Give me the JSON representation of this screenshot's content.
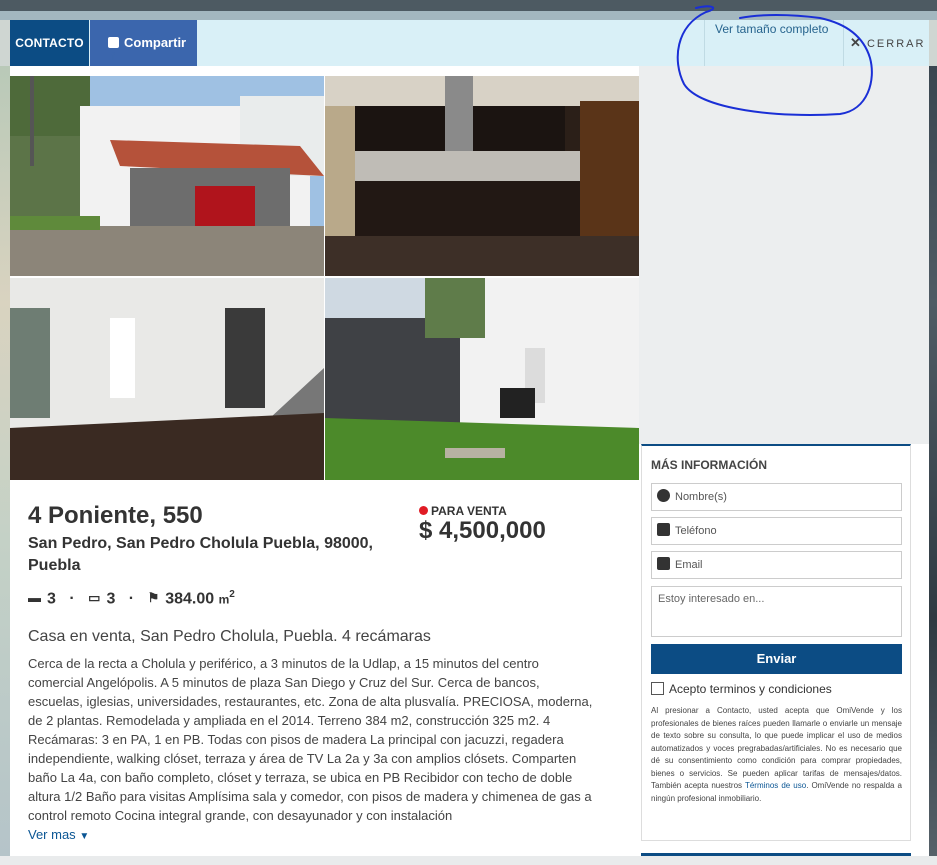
{
  "header": {
    "contact_label": "CONTACTO",
    "share_label": "Compartir",
    "full_size_label": "Ver tamaño completo",
    "close_label": "CERRAR"
  },
  "gallery": [
    {
      "name": "photo-house-exterior"
    },
    {
      "name": "photo-kitchen"
    },
    {
      "name": "photo-living-room"
    },
    {
      "name": "photo-garden"
    }
  ],
  "listing": {
    "title": "4 Poniente, 550",
    "address": "San Pedro, San Pedro Cholula Puebla, 98000, Puebla",
    "status": "PARA VENTA",
    "price": "$ 4,500,000",
    "bedrooms": "3",
    "bathrooms": "3",
    "area": "384.00",
    "area_unit": "m",
    "area_exp": "2",
    "separator": "·",
    "subtitle": "Casa en venta, San Pedro Cholula, Puebla. 4 recámaras",
    "description": "Cerca de la recta a Cholula y periférico, a 3 minutos de la Udlap, a 15 minutos del centro comercial Angelópolis. A 5 minutos de plaza San Diego y Cruz del Sur. Cerca de bancos, escuelas, iglesias, universidades, restaurantes, etc. Zona de alta plusvalía. PRECIOSA, moderna, de 2 plantas. Remodelada y ampliada en el 2014. Terreno 384 m2, construcción 325 m2. 4 Recámaras: 3 en PA, 1 en PB. Todas con pisos de madera La principal con jacuzzi, regadera independiente, walking clóset, terraza y área de TV La 2a y 3a con amplios clósets. Comparten baño La 4a, con baño completo, clóset y terraza, se ubica en PB Recibidor con techo de doble altura 1/2 Baño para visitas Amplísima sala y comedor, con pisos de madera y chimenea de gas a control remoto Cocina integral grande, con desayunador y con instalación",
    "see_more": "Ver mas"
  },
  "form": {
    "title": "MÁS INFORMACIÓN",
    "name_placeholder": "Nombre(s)",
    "phone_placeholder": "Teléfono",
    "email_placeholder": "Email",
    "message_placeholder": "Estoy interesado en...",
    "submit_label": "Enviar",
    "terms_label": "Acepto terminos y condiciones",
    "legal_text": "Al presionar a Contacto, usted acepta que OmiVende y los profesionales de bienes raíces pueden llamarle o enviarle un mensaje de texto sobre su consulta, lo que puede implicar el uso de medios automatizados y voces pregrabadas/artificiales. No es necesario que dé su consentimiento como condición para comprar propiedades, bienes o servicios. Se pueden aplicar tarifas de mensajes/datos. También acepta nuestros",
    "legal_link": "Términos de uso",
    "legal_tail": ". OmiVende no respalda a ningún profesional inmobiliario."
  },
  "colors": {
    "primary": "#0c4c84",
    "facebook": "#3b66ad",
    "header_bg": "#d9f0f7",
    "status_red": "#e01b24",
    "annotation_ink": "#1a2fd6"
  }
}
